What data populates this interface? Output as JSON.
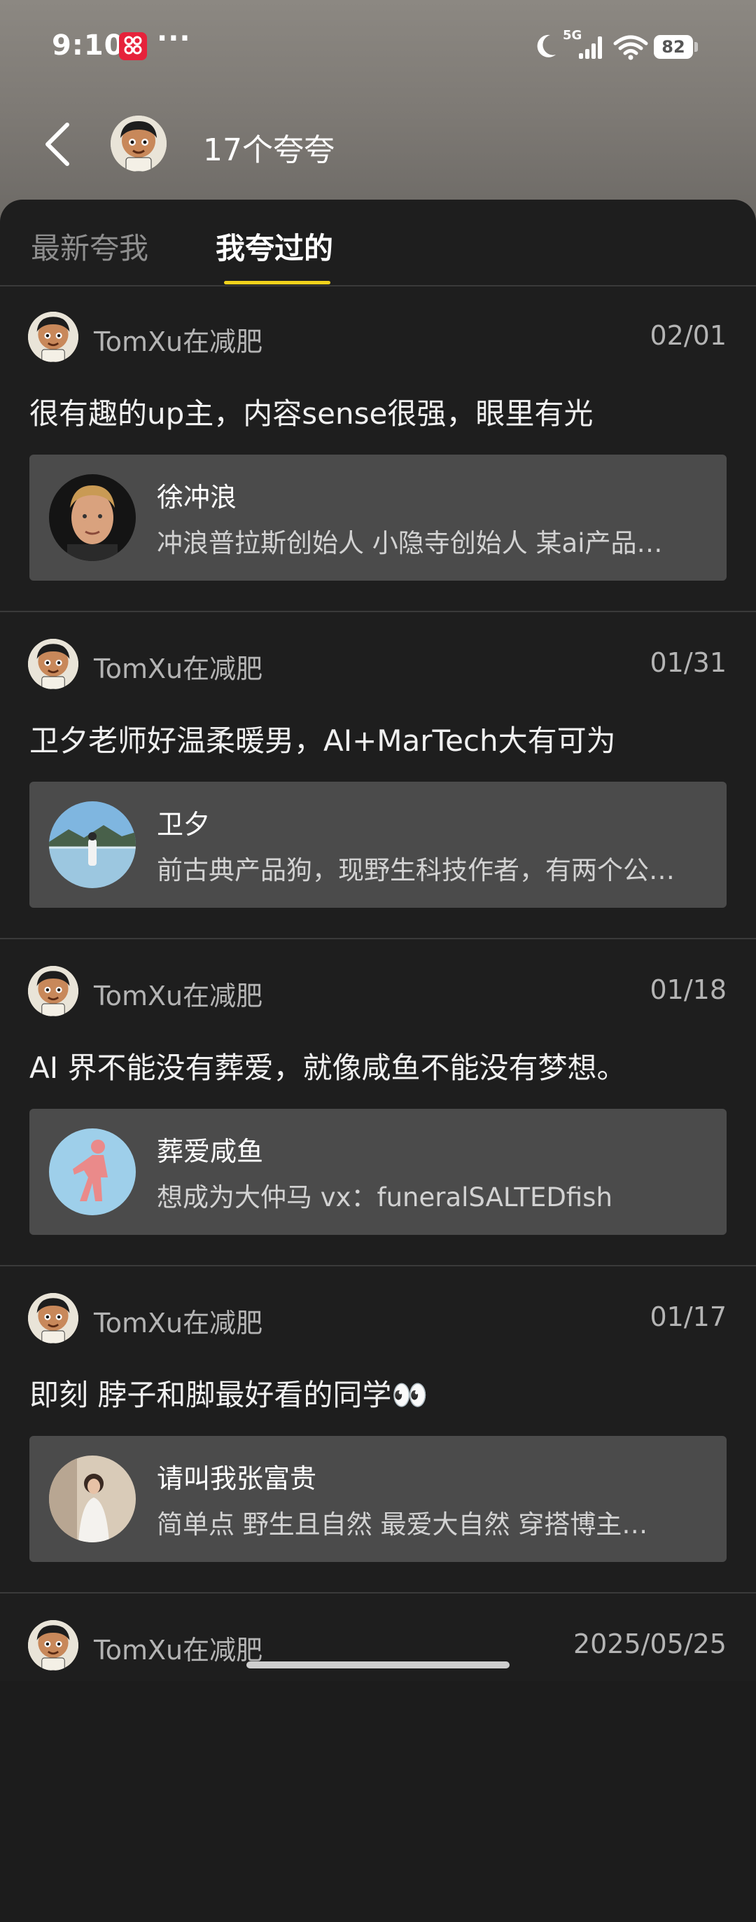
{
  "status_bar": {
    "time": "9:10",
    "more": "···",
    "network": "5G",
    "battery": "82"
  },
  "header": {
    "title": "17个夸夸"
  },
  "tabs": [
    {
      "label": "最新夸我",
      "active": false
    },
    {
      "label": "我夸过的",
      "active": true
    }
  ],
  "colors": {
    "accent": "#f2d21c",
    "panel": "#1e1e1e",
    "card": "#4b4b4b"
  },
  "entries": [
    {
      "user": "TomXu在减肥",
      "date": "02/01",
      "text": "很有趣的up主，内容sense很强，眼里有光",
      "card": {
        "name": "徐冲浪",
        "bio": "冲浪普拉斯创始人 小隐寺创始人 某ai产品…"
      }
    },
    {
      "user": "TomXu在减肥",
      "date": "01/31",
      "text": "卫夕老师好温柔暖男，AI+MarTech大有可为",
      "card": {
        "name": "卫夕",
        "bio": "前古典产品狗，现野生科技作者，有两个公…"
      }
    },
    {
      "user": "TomXu在减肥",
      "date": "01/18",
      "text": "AI 界不能没有葬爱，就像咸鱼不能没有梦想。",
      "card": {
        "name": "葬爱咸鱼",
        "bio": "想成为大仲马 vx：funeralSALTEDfish"
      }
    },
    {
      "user": "TomXu在减肥",
      "date": "01/17",
      "text": "即刻 脖子和脚最好看的同学👀",
      "card": {
        "name": "请叫我张富贵",
        "bio": "简单点  野生且自然 最爱大自然 穿搭博主…"
      }
    },
    {
      "user": "TomXu在减肥",
      "date": "2025/05/25"
    }
  ]
}
